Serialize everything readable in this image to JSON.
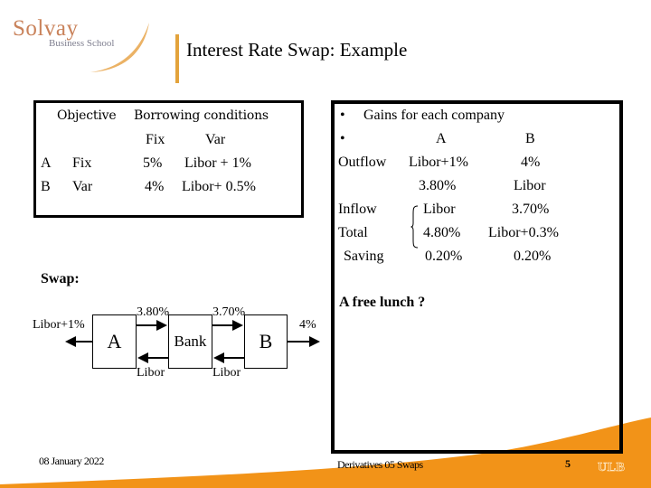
{
  "header": {
    "logo_primary": "Solvay",
    "logo_secondary": "Business School",
    "title": "Interest Rate Swap: Example"
  },
  "colors": {
    "accent_orange": "#f0921a",
    "divider": "#e3a33c",
    "logo_text": "#c9825a"
  },
  "conditions": {
    "header_objective": "Objective",
    "header_borrowing": "Borrowing conditions",
    "col_fix": "Fix",
    "col_var": "Var",
    "rows": [
      {
        "company": "A",
        "objective": "Fix",
        "fix": "5%",
        "var": "Libor + 1%"
      },
      {
        "company": "B",
        "objective": "Var",
        "fix": "4%",
        "var": "Libor+ 0.5%"
      }
    ]
  },
  "gains": {
    "bullet": "•",
    "heading": "Gains for each company",
    "col_a": "A",
    "col_b": "B",
    "rows": [
      {
        "label": "Outflow",
        "a": "Libor+1%",
        "b": "4%"
      },
      {
        "label": "",
        "a": "3.80%",
        "b": "Libor"
      },
      {
        "label": "Inflow",
        "a": "Libor",
        "b": "3.70%"
      },
      {
        "label": "Total",
        "a": "4.80%",
        "b": "Libor+0.3%"
      },
      {
        "label": "Saving",
        "a": "0.20%",
        "b": "0.20%"
      }
    ],
    "note": "A free lunch ?"
  },
  "swap": {
    "label": "Swap:",
    "nodes": {
      "a": "A",
      "bank": "Bank",
      "b": "B"
    },
    "flows": {
      "a_out": "Libor+1%",
      "a_to_bank": "3.80%",
      "bank_to_a": "Libor",
      "bank_to_b": "3.70%",
      "b_to_bank": "Libor",
      "b_out": "4%"
    }
  },
  "footer": {
    "date": "08 January 2022",
    "course": "Derivatives 05 Swaps",
    "page": "5",
    "institution_logo": "ULB"
  }
}
